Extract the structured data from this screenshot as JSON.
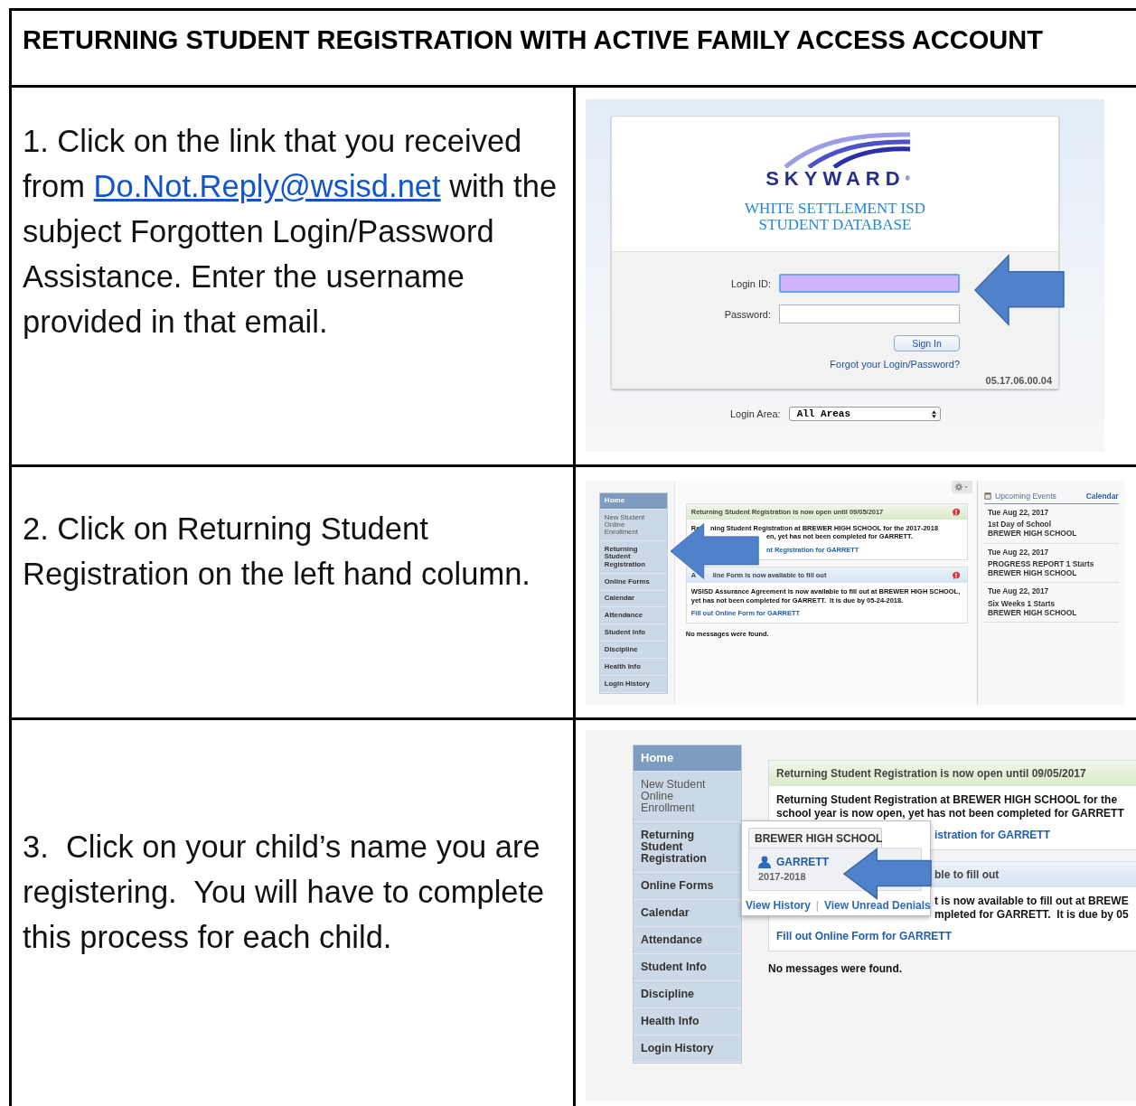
{
  "title": "RETURNING STUDENT REGISTRATION WITH ACTIVE FAMILY ACCESS ACCOUNT",
  "steps": [
    {
      "instruction": {
        "before": "1. Click on the link that you received from ",
        "link": "Do.Not.Reply@wsisd.net",
        "after": " with the subject Forgotten Login/Password Assistance. Enter the username provided in that email."
      },
      "screenshot": {
        "kind": "login",
        "logo_text": "SKYWARD",
        "logo_mark": "®",
        "district": [
          "WHITE SETTLEMENT ISD",
          "STUDENT DATABASE"
        ],
        "fields": [
          {
            "label": "Login ID:",
            "focused": true
          },
          {
            "label": "Password:",
            "focused": false
          }
        ],
        "button": "Sign In",
        "link": "Forgot your Login/Password?",
        "version": "05.17.06.00.04",
        "area_label": "Login Area:",
        "area_value": "All Areas",
        "arrow": true
      }
    },
    {
      "instruction": {
        "before": "2. Click on Returning Student Registration on the left hand column."
      },
      "screenshot": {
        "kind": "home_small",
        "gear": true,
        "arrow": true,
        "nav": [
          {
            "label": "Home",
            "selected": true,
            "disabled": false
          },
          {
            "label": "New Student Online Enrollment",
            "selected": false,
            "disabled": true
          },
          {
            "label": "Returning Student Registration",
            "selected": false,
            "disabled": false
          },
          {
            "label": "Online Forms",
            "selected": false,
            "disabled": false
          },
          {
            "label": "Calendar",
            "selected": false,
            "disabled": false
          },
          {
            "label": "Attendance",
            "selected": false,
            "disabled": false
          },
          {
            "label": "Student Info",
            "selected": false,
            "disabled": false
          },
          {
            "label": "Discipline",
            "selected": false,
            "disabled": false
          },
          {
            "label": "Health Info",
            "selected": false,
            "disabled": false
          },
          {
            "label": "Login History",
            "selected": false,
            "disabled": false
          }
        ],
        "messages": [
          {
            "color": "#dbeac9",
            "alert": true,
            "head": {
              "before": "Returning Student Registration is now open until 09/05/2017"
            },
            "lines": [
              {
                "before": "Re",
                "after": "ning Student Registration at BREWER HIGH SCHOOL for the 2017-2018",
                "link": false
              },
              {
                "after": "en, yet has not been completed for GARRETT.",
                "link": false
              },
              {
                "after": "nt Registration for GARRETT",
                "link": true
              }
            ]
          },
          {
            "color": "#d4e3f3",
            "alert": true,
            "head": {
              "before": "A",
              "after": "line Form is now available to fill out"
            },
            "lines": [
              {
                "before": "WSISD Assurance Agreement is now available to fill out at BREWER HIGH SCHOOL, yet has not been completed for GARRETT.  It is due by 05-24-2018.",
                "link": false
              },
              {
                "before": "Fill out Online Form for GARRETT",
                "link": true
              }
            ]
          }
        ],
        "no_messages": "No messages were found.",
        "events": {
          "title": "Upcoming Events",
          "link": "Calendar",
          "items": [
            {
              "date": "Tue Aug 22, 2017",
              "name": "1st Day of School",
              "school": "BREWER HIGH SCHOOL"
            },
            {
              "date": "Tue Aug 22, 2017",
              "name": "PROGRESS REPORT 1 Starts",
              "school": "BREWER HIGH SCHOOL"
            },
            {
              "date": "Tue Aug 22, 2017",
              "name": "Six Weeks 1 Starts",
              "school": "BREWER HIGH SCHOOL"
            }
          ]
        }
      }
    },
    {
      "instruction": {
        "before": "3.  Click on your child’s name you are registering.  You will have to complete this process for each child."
      },
      "screenshot": {
        "kind": "home_large",
        "arrow": true,
        "nav": [
          {
            "label": "Home",
            "selected": true,
            "disabled": false
          },
          {
            "label": "New Student Online Enrollment",
            "selected": false,
            "disabled": true
          },
          {
            "label": "Returning Student Registration",
            "selected": false,
            "disabled": false
          },
          {
            "label": "Online Forms",
            "selected": false,
            "disabled": false
          },
          {
            "label": "Calendar",
            "selected": false,
            "disabled": false
          },
          {
            "label": "Attendance",
            "selected": false,
            "disabled": false
          },
          {
            "label": "Student Info",
            "selected": false,
            "disabled": false
          },
          {
            "label": "Discipline",
            "selected": false,
            "disabled": false
          },
          {
            "label": "Health Info",
            "selected": false,
            "disabled": false
          },
          {
            "label": "Login History",
            "selected": false,
            "disabled": false
          }
        ],
        "messages": [
          {
            "color": "#dbeac9",
            "alert": false,
            "head": {
              "before": "Returning Student Registration is now open until 09/05/2017"
            },
            "lines": [
              {
                "before": "Returning Student Registration at BREWER HIGH SCHOOL for the",
                "link": false
              },
              {
                "before": "school year is now open, yet has not been completed for GARRETT",
                "link": false
              },
              {
                "after": "istration for GARRETT",
                "link": true
              }
            ]
          },
          {
            "color": "#d4e3f3",
            "alert": false,
            "head": {
              "after": "ble to fill out"
            },
            "lines": [
              {
                "after": "t is now available to fill out at BREWE",
                "link": false
              },
              {
                "after": "mpleted for GARRETT.  It is due by 05",
                "link": false
              },
              {
                "before": "Fill out Online Form for GARRETT",
                "link": true
              }
            ]
          }
        ],
        "no_messages": "No messages were found.",
        "popup": {
          "tab": "BREWER HIGH SCHOOL",
          "student": "GARRETT",
          "year": "2017-2018",
          "links": [
            "View History",
            "View Unread Denials"
          ],
          "separator": "|"
        }
      }
    }
  ]
}
